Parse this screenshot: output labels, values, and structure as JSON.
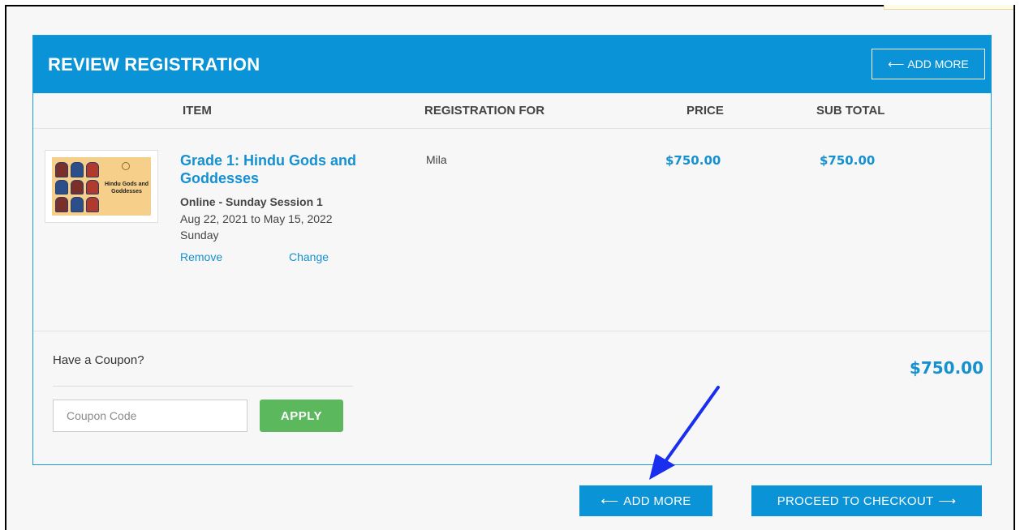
{
  "panel": {
    "title": "REVIEW REGISTRATION",
    "add_more_label": "ADD MORE",
    "accent_color": "#0a93d6"
  },
  "columns": {
    "item": "ITEM",
    "registration_for": "REGISTRATION FOR",
    "price": "PRICE",
    "sub_total": "SUB TOTAL"
  },
  "cart_item": {
    "image_text": "Hindu Gods and Goddesses",
    "title": "Grade 1: Hindu Gods and Goddesses",
    "session": "Online - Sunday Session 1",
    "dates": "Aug 22, 2021 to May 15, 2022",
    "day": "Sunday",
    "remove_label": "Remove",
    "change_label": "Change",
    "registration_for": "Mila",
    "price": "$750.00",
    "sub_total": "$750.00"
  },
  "coupon": {
    "label": "Have a Coupon?",
    "placeholder": "Coupon Code",
    "apply_label": "APPLY"
  },
  "total": "$750.00",
  "footer": {
    "add_more_label": "ADD MORE",
    "checkout_label": "PROCEED TO CHECKOUT"
  },
  "icons": {
    "back_arrow": "left-arrow-icon",
    "forward_arrow": "right-arrow-icon",
    "annotation": "blue-arrow-annotation"
  }
}
